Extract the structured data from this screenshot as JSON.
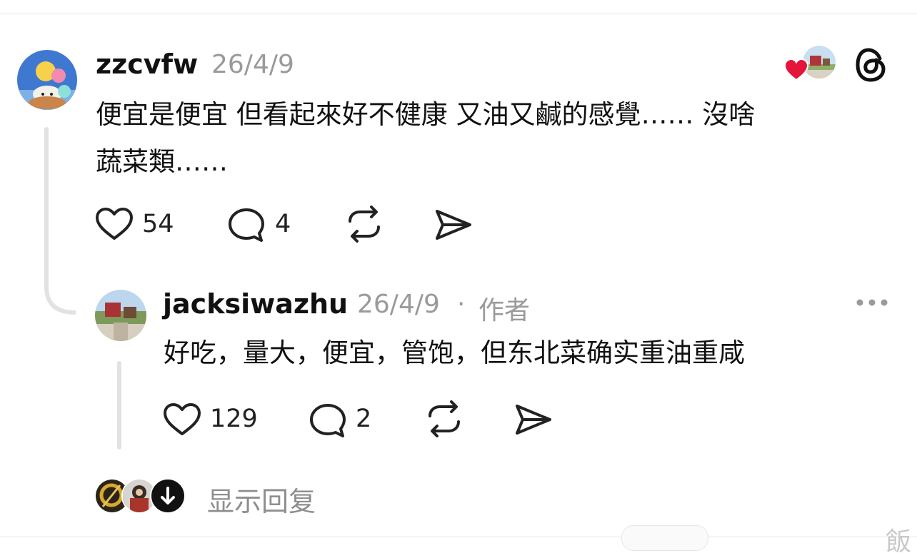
{
  "top_comment": {
    "username": "zzcvfw",
    "date": "26/4/9",
    "text_line1": "便宜是便宜 但看起來好不健康 又油又鹹的感覺…… 沒啥",
    "text_line2": "蔬菜類……",
    "likes": "54",
    "replies": "4",
    "icons": [
      "heart-icon",
      "comment-icon",
      "repost-icon",
      "share-icon"
    ]
  },
  "reply": {
    "username": "jacksiwazhu",
    "date": "26/4/9",
    "separator": "·",
    "author_tag": "作者",
    "text": "好吃，量大，便宜，管饱，但东北菜确实重油重咸",
    "likes": "129",
    "replies": "2",
    "more_label": "•••"
  },
  "show_replies": {
    "label": "显示回复"
  },
  "watermark": {
    "text": "飯"
  },
  "colors": {
    "heart_red": "#e5143a",
    "muted_text": "#9a9a9a",
    "thread_line": "#e2e2e2"
  }
}
